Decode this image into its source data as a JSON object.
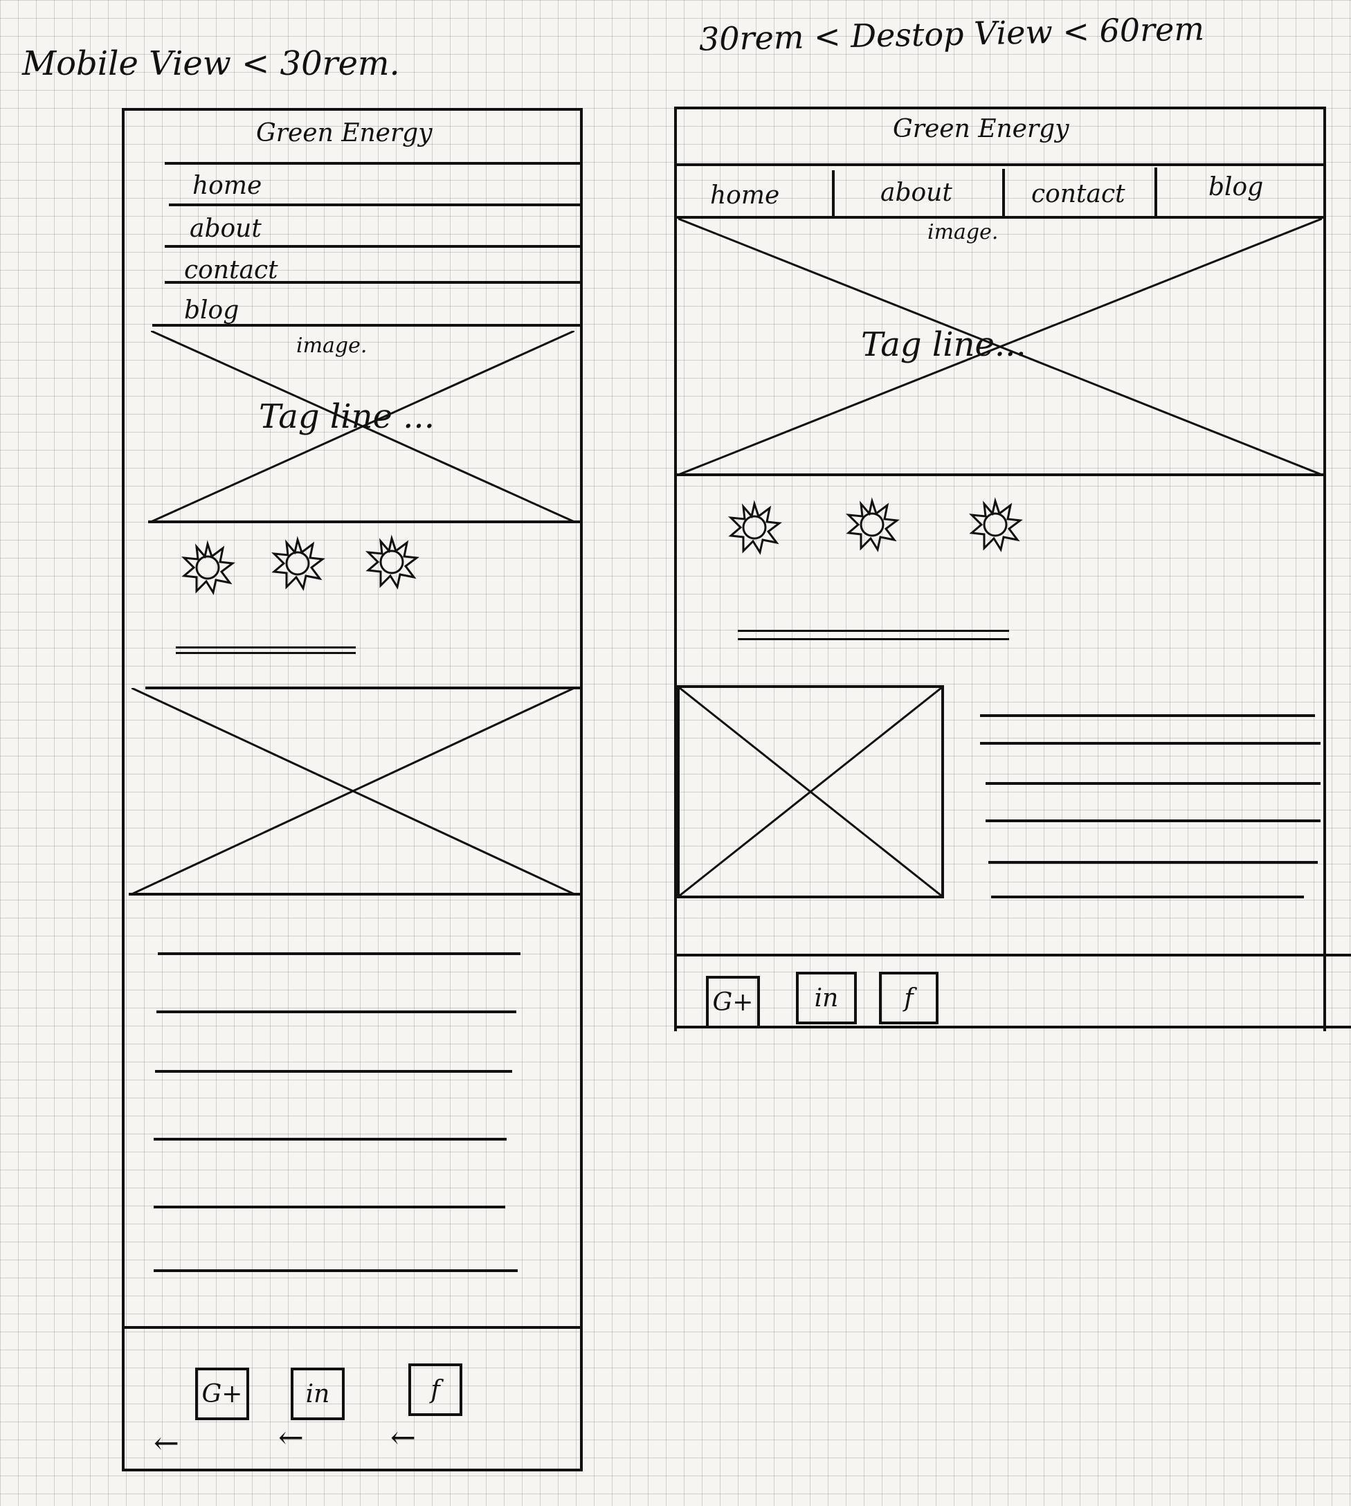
{
  "annotations": {
    "mobile_title": "Mobile View < 30rem.",
    "desktop_title": "30rem < Destop View < 60rem"
  },
  "mobile": {
    "site_title": "Green Energy",
    "nav": [
      "home",
      "about",
      "contact",
      "blog"
    ],
    "hero_image_label": "image.",
    "tagline": "Tag line ...",
    "social": [
      "G+",
      "in",
      "f"
    ],
    "back_arrow": "←"
  },
  "desktop": {
    "site_title": "Green Energy",
    "nav": [
      "home",
      "about",
      "contact",
      "blog"
    ],
    "hero_image_label": "image.",
    "tagline": "Tag line...",
    "social": [
      "G+",
      "in",
      "f"
    ]
  }
}
